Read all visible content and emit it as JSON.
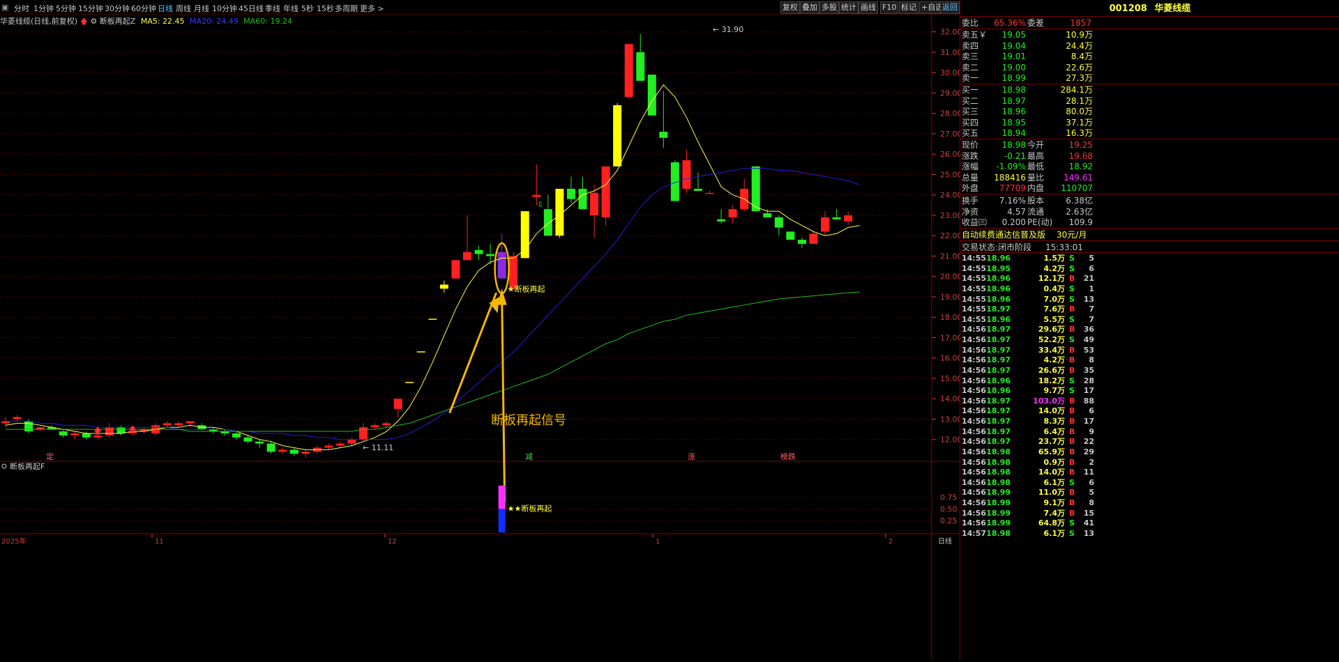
{
  "toolbar": {
    "periods": [
      "分时",
      "1分钟",
      "5分钟",
      "15分钟",
      "30分钟",
      "60分钟",
      "日线",
      "周线",
      "月线",
      "10分钟",
      "45日线",
      "季线",
      "年线",
      "5秒",
      "15秒",
      "多周期",
      "更多"
    ],
    "active_period": "日线",
    "right_buttons": [
      "复权",
      "叠加",
      "多股",
      "统计",
      "画线",
      "F10",
      "标记",
      "+自选",
      "返回"
    ]
  },
  "info": {
    "stock_title": "华菱线缆(日线,前复权)",
    "indicator_name": "断板再起Z",
    "ma5": "MA5: 22.45",
    "ma20": "MA20: 24.49",
    "ma60": "MA60: 19.24"
  },
  "colors": {
    "up": "#ff2020",
    "down": "#22ee22",
    "yellow": "#ffff00",
    "ma5": "#ffff40",
    "ma20": "#2020dd",
    "ma60": "#20c020",
    "grid": "#5a0000",
    "annotation": "#f5b800",
    "signal": "#8a2be2"
  },
  "chart": {
    "y_ticks": [
      "32.00",
      "31.00",
      "30.00",
      "29.00",
      "28.00",
      "27.00",
      "26.00",
      "25.00",
      "24.00",
      "23.00",
      "22.00",
      "21.00",
      "20.00",
      "19.00",
      "18.00",
      "17.00",
      "16.00",
      "15.00",
      "14.00",
      "13.00",
      "12.00"
    ],
    "high_label": "31.90",
    "low_label": "11.11",
    "signal_label": "断板再起",
    "annotation_text": "断板再起信号",
    "bottom_markers": [
      "定",
      "减",
      "涨",
      "榜跌"
    ],
    "ylim": [
      11,
      32.5
    ],
    "candles": [
      [
        12.8,
        13.1,
        12.6,
        12.9
      ],
      [
        13.0,
        13.2,
        12.9,
        13.1
      ],
      [
        12.9,
        13.0,
        12.3,
        12.4
      ],
      [
        12.5,
        12.6,
        12.4,
        12.6
      ],
      [
        12.6,
        12.7,
        12.5,
        12.5
      ],
      [
        12.4,
        12.5,
        12.1,
        12.2
      ],
      [
        12.2,
        12.4,
        12.0,
        12.3
      ],
      [
        12.3,
        12.4,
        12.0,
        12.1
      ],
      [
        12.1,
        12.3,
        12.0,
        12.2
      ],
      [
        12.2,
        12.8,
        12.1,
        12.6
      ],
      [
        12.6,
        12.7,
        12.2,
        12.3
      ],
      [
        12.3,
        12.5,
        12.2,
        12.4
      ],
      [
        12.4,
        12.6,
        12.3,
        12.5
      ],
      [
        12.3,
        12.8,
        12.2,
        12.7
      ],
      [
        12.7,
        12.9,
        12.6,
        12.8
      ],
      [
        12.7,
        12.9,
        12.6,
        12.8
      ],
      [
        12.8,
        12.9,
        12.6,
        12.9
      ],
      [
        12.7,
        12.8,
        12.5,
        12.5
      ],
      [
        12.5,
        12.6,
        12.3,
        12.4
      ],
      [
        12.4,
        12.5,
        12.2,
        12.3
      ],
      [
        12.3,
        12.4,
        12.0,
        12.1
      ],
      [
        12.1,
        12.2,
        11.8,
        11.9
      ],
      [
        11.9,
        12.0,
        11.6,
        11.8
      ],
      [
        11.8,
        11.9,
        11.3,
        11.4
      ],
      [
        11.4,
        11.6,
        11.3,
        11.5
      ],
      [
        11.5,
        11.6,
        11.2,
        11.3
      ],
      [
        11.3,
        11.5,
        11.11,
        11.4
      ],
      [
        11.4,
        11.7,
        11.3,
        11.6
      ],
      [
        11.6,
        11.8,
        11.5,
        11.7
      ],
      [
        11.7,
        11.9,
        11.6,
        11.8
      ],
      [
        11.8,
        12.1,
        11.7,
        12.0
      ],
      [
        12.0,
        12.8,
        11.9,
        12.6
      ],
      [
        12.6,
        12.8,
        12.5,
        12.7
      ],
      [
        12.7,
        12.9,
        12.6,
        12.8
      ],
      [
        13.5,
        14.0,
        13.1,
        14.0
      ],
      [
        14.8,
        14.8,
        14.8,
        14.8
      ],
      [
        16.3,
        16.3,
        16.3,
        16.3
      ],
      [
        17.9,
        17.9,
        17.9,
        17.9
      ],
      [
        19.6,
        19.8,
        19.2,
        19.4
      ],
      [
        19.9,
        20.8,
        19.9,
        20.8
      ],
      [
        20.8,
        23.0,
        20.8,
        21.2
      ],
      [
        21.3,
        21.5,
        20.8,
        21.1
      ],
      [
        21.1,
        21.6,
        20.6,
        21.0
      ],
      [
        21.2,
        22.1,
        19.9,
        19.9
      ],
      [
        19.4,
        21.2,
        19.3,
        21.0
      ],
      [
        20.9,
        23.2,
        20.9,
        23.2
      ],
      [
        23.9,
        25.5,
        23.5,
        24.0
      ],
      [
        23.3,
        24.0,
        22.0,
        22.0
      ],
      [
        22.0,
        24.3,
        21.9,
        24.3
      ],
      [
        24.3,
        24.9,
        23.6,
        23.8
      ],
      [
        24.3,
        24.9,
        23.4,
        23.3
      ],
      [
        23.0,
        24.5,
        21.9,
        24.1
      ],
      [
        22.9,
        25.3,
        22.5,
        25.4
      ],
      [
        25.4,
        28.5,
        25.4,
        28.4
      ],
      [
        28.8,
        31.4,
        28.8,
        31.4
      ],
      [
        31.0,
        31.9,
        29.6,
        29.6
      ],
      [
        29.9,
        29.9,
        27.9,
        27.9
      ],
      [
        27.1,
        29.1,
        26.3,
        26.8
      ],
      [
        25.6,
        25.7,
        23.7,
        23.7
      ],
      [
        24.3,
        26.2,
        24.1,
        25.7
      ],
      [
        24.3,
        25.1,
        24.2,
        24.2
      ],
      [
        24.1,
        24.2,
        24.1,
        24.1
      ],
      [
        22.8,
        23.3,
        22.6,
        22.7
      ],
      [
        22.9,
        23.5,
        22.6,
        23.3
      ],
      [
        23.3,
        24.8,
        23.2,
        24.3
      ],
      [
        25.4,
        25.4,
        23.2,
        23.2
      ],
      [
        23.1,
        23.3,
        22.9,
        22.9
      ],
      [
        22.9,
        23.0,
        22.0,
        22.4
      ],
      [
        22.2,
        22.2,
        21.8,
        21.8
      ],
      [
        21.8,
        21.9,
        21.4,
        21.6
      ],
      [
        21.6,
        22.2,
        21.6,
        22.1
      ],
      [
        22.2,
        23.2,
        22.0,
        22.9
      ],
      [
        22.9,
        23.3,
        22.8,
        22.8
      ],
      [
        22.7,
        23.2,
        22.5,
        23.0
      ]
    ],
    "special_candle_index": 50,
    "ma5": [
      12.7,
      12.8,
      12.8,
      12.7,
      12.6,
      12.5,
      12.4,
      12.3,
      12.3,
      12.3,
      12.3,
      12.4,
      12.4,
      12.5,
      12.6,
      12.6,
      12.7,
      12.6,
      12.6,
      12.5,
      12.4,
      12.2,
      12.0,
      11.9,
      11.7,
      11.6,
      11.5,
      11.5,
      11.5,
      11.6,
      11.7,
      11.9,
      12.1,
      12.4,
      12.9,
      13.6,
      14.6,
      15.8,
      17.1,
      18.4,
      19.5,
      20.3,
      20.7,
      20.9,
      20.9,
      21.3,
      22.1,
      22.6,
      23.0,
      23.5,
      24.0,
      24.2,
      24.5,
      25.2,
      26.4,
      27.6,
      28.6,
      29.4,
      28.8,
      27.8,
      26.6,
      25.5,
      24.4,
      24.0,
      23.8,
      23.4,
      23.2,
      23.2,
      22.8,
      22.5,
      22.2,
      22.0,
      22.1,
      22.4,
      22.5
    ],
    "ma20": [
      12.9,
      12.9,
      12.9,
      12.8,
      12.8,
      12.7,
      12.7,
      12.7,
      12.6,
      12.6,
      12.6,
      12.6,
      12.6,
      12.6,
      12.6,
      12.5,
      12.5,
      12.5,
      12.5,
      12.5,
      12.4,
      12.4,
      12.3,
      12.3,
      12.3,
      12.2,
      12.2,
      12.1,
      12.1,
      12.0,
      12.0,
      12.0,
      12.0,
      12.0,
      12.1,
      12.3,
      12.6,
      12.9,
      13.3,
      13.8,
      14.3,
      14.8,
      15.3,
      15.8,
      16.3,
      16.9,
      17.5,
      18.1,
      18.7,
      19.3,
      19.9,
      20.5,
      21.1,
      21.8,
      22.6,
      23.4,
      24.0,
      24.4,
      24.6,
      24.8,
      24.9,
      25.0,
      25.1,
      25.2,
      25.3,
      25.3,
      25.3,
      25.2,
      25.2,
      25.1,
      25.0,
      24.9,
      24.8,
      24.7,
      24.5
    ],
    "ma60": [
      12.5,
      12.5,
      12.5,
      12.5,
      12.5,
      12.5,
      12.5,
      12.5,
      12.5,
      12.5,
      12.5,
      12.5,
      12.5,
      12.5,
      12.5,
      12.5,
      12.4,
      12.4,
      12.4,
      12.4,
      12.4,
      12.4,
      12.4,
      12.4,
      12.4,
      12.4,
      12.4,
      12.4,
      12.4,
      12.4,
      12.4,
      12.5,
      12.5,
      12.6,
      12.7,
      12.8,
      13.0,
      13.2,
      13.4,
      13.6,
      13.8,
      14.0,
      14.2,
      14.4,
      14.6,
      14.8,
      15.0,
      15.2,
      15.5,
      15.8,
      16.1,
      16.4,
      16.7,
      16.9,
      17.2,
      17.4,
      17.6,
      17.8,
      17.9,
      18.1,
      18.2,
      18.3,
      18.4,
      18.5,
      18.6,
      18.7,
      18.8,
      18.9,
      18.95,
      19.0,
      19.05,
      19.1,
      19.15,
      19.2,
      19.24
    ]
  },
  "sub_chart": {
    "title": "断板再起F",
    "y_ticks": [
      "0.75",
      "0.50",
      "0.25"
    ],
    "signal_label": "★★断板再起",
    "bar_values": [
      1.0,
      0.5
    ],
    "ylim": [
      0,
      1.25
    ]
  },
  "axis": {
    "x_labels": [
      "2025年",
      "11",
      "12",
      "1",
      "2"
    ],
    "period_label": "日线"
  },
  "sidebar": {
    "code": "001208",
    "name": "华菱线缆",
    "weibi_label": "委比",
    "weibi": "65.36%",
    "weicha_label": "委差",
    "weicha": "1857",
    "asks": [
      {
        "label": "卖五",
        "price": "19.05",
        "vol": "10.9万"
      },
      {
        "label": "卖四",
        "price": "19.04",
        "vol": "24.4万"
      },
      {
        "label": "卖三",
        "price": "19.01",
        "vol": "8.4万"
      },
      {
        "label": "卖二",
        "price": "19.00",
        "vol": "22.6万"
      },
      {
        "label": "卖一",
        "price": "18.99",
        "vol": "27.3万"
      }
    ],
    "bids": [
      {
        "label": "买一",
        "price": "18.98",
        "vol": "284.1万"
      },
      {
        "label": "买二",
        "price": "18.97",
        "vol": "28.1万"
      },
      {
        "label": "买三",
        "price": "18.96",
        "vol": "80.0万"
      },
      {
        "label": "买四",
        "price": "18.95",
        "vol": "37.1万"
      },
      {
        "label": "买五",
        "price": "18.94",
        "vol": "16.3万"
      }
    ],
    "stats": [
      {
        "l1": "现价",
        "v1": "18.98",
        "c1": "#22ee22",
        "l2": "今开",
        "v2": "19.25",
        "c2": "#ff3030"
      },
      {
        "l1": "涨跌",
        "v1": "-0.21",
        "c1": "#22ee22",
        "l2": "最高",
        "v2": "19.68",
        "c2": "#ff3030"
      },
      {
        "l1": "涨幅",
        "v1": "-1.09%",
        "c1": "#22ee22",
        "l2": "最低",
        "v2": "18.92",
        "c2": "#22ee22"
      },
      {
        "l1": "总量",
        "v1": "188416",
        "c1": "#ffff40",
        "l2": "量比",
        "v2": "149.61",
        "c2": "#ff30ff"
      },
      {
        "l1": "外盘",
        "v1": "77709",
        "c1": "#ff3030",
        "l2": "内盘",
        "v2": "110707",
        "c2": "#22ee22"
      }
    ],
    "stats2": [
      {
        "l1": "换手",
        "v1": "7.16%",
        "l2": "股本",
        "v2": "6.38亿"
      },
      {
        "l1": "净资",
        "v1": "4.57",
        "l2": "流通",
        "v2": "2.63亿"
      },
      {
        "l1": "收益㈢",
        "v1": "0.200",
        "l2": "PE(动)",
        "v2": "109.9"
      }
    ],
    "promo": "自动续费通达信普及版",
    "promo_price": "30元/月",
    "trade_state_label": "交易状态:",
    "trade_state": "闭市阶段",
    "trade_time": "15:33:01",
    "trades": [
      {
        "t": "14:55",
        "p": "18.96",
        "v": "1.5万",
        "s": "S",
        "n": "5"
      },
      {
        "t": "14:55",
        "p": "18.95",
        "v": "4.2万",
        "s": "S",
        "n": "6"
      },
      {
        "t": "14:55",
        "p": "18.96",
        "v": "12.1万",
        "s": "B",
        "n": "21"
      },
      {
        "t": "14:55",
        "p": "18.96",
        "v": "0.4万",
        "s": "S",
        "n": "1"
      },
      {
        "t": "14:55",
        "p": "18.96",
        "v": "7.0万",
        "s": "S",
        "n": "13"
      },
      {
        "t": "14:55",
        "p": "18.97",
        "v": "7.6万",
        "s": "B",
        "n": "7"
      },
      {
        "t": "14:55",
        "p": "18.96",
        "v": "5.5万",
        "s": "S",
        "n": "7"
      },
      {
        "t": "14:56",
        "p": "18.97",
        "v": "29.6万",
        "s": "B",
        "n": "36"
      },
      {
        "t": "14:56",
        "p": "18.97",
        "v": "52.2万",
        "s": "S",
        "n": "49"
      },
      {
        "t": "14:56",
        "p": "18.97",
        "v": "33.4万",
        "s": "B",
        "n": "53"
      },
      {
        "t": "14:56",
        "p": "18.97",
        "v": "4.2万",
        "s": "B",
        "n": "8"
      },
      {
        "t": "14:56",
        "p": "18.97",
        "v": "26.6万",
        "s": "B",
        "n": "35"
      },
      {
        "t": "14:56",
        "p": "18.96",
        "v": "18.2万",
        "s": "S",
        "n": "28"
      },
      {
        "t": "14:56",
        "p": "18.96",
        "v": "9.7万",
        "s": "S",
        "n": "17"
      },
      {
        "t": "14:56",
        "p": "18.97",
        "v": "103.0万",
        "s": "B",
        "n": "88"
      },
      {
        "t": "14:56",
        "p": "18.97",
        "v": "14.0万",
        "s": "B",
        "n": "6"
      },
      {
        "t": "14:56",
        "p": "18.97",
        "v": "8.3万",
        "s": "B",
        "n": "17"
      },
      {
        "t": "14:56",
        "p": "18.97",
        "v": "6.4万",
        "s": "B",
        "n": "9"
      },
      {
        "t": "14:56",
        "p": "18.97",
        "v": "23.7万",
        "s": "B",
        "n": "22"
      },
      {
        "t": "14:56",
        "p": "18.98",
        "v": "65.9万",
        "s": "B",
        "n": "29"
      },
      {
        "t": "14:56",
        "p": "18.98",
        "v": "0.9万",
        "s": "B",
        "n": "2"
      },
      {
        "t": "14:56",
        "p": "18.98",
        "v": "14.0万",
        "s": "B",
        "n": "11"
      },
      {
        "t": "14:56",
        "p": "18.98",
        "v": "6.1万",
        "s": "S",
        "n": "6"
      },
      {
        "t": "14:56",
        "p": "18.99",
        "v": "11.0万",
        "s": "B",
        "n": "5"
      },
      {
        "t": "14:56",
        "p": "18.99",
        "v": "9.1万",
        "s": "B",
        "n": "8"
      },
      {
        "t": "14:56",
        "p": "18.99",
        "v": "7.4万",
        "s": "B",
        "n": "15"
      },
      {
        "t": "14:56",
        "p": "18.99",
        "v": "64.8万",
        "s": "S",
        "n": "41"
      },
      {
        "t": "14:57",
        "p": "18.98",
        "v": "6.1万",
        "s": "S",
        "n": "13"
      }
    ]
  }
}
